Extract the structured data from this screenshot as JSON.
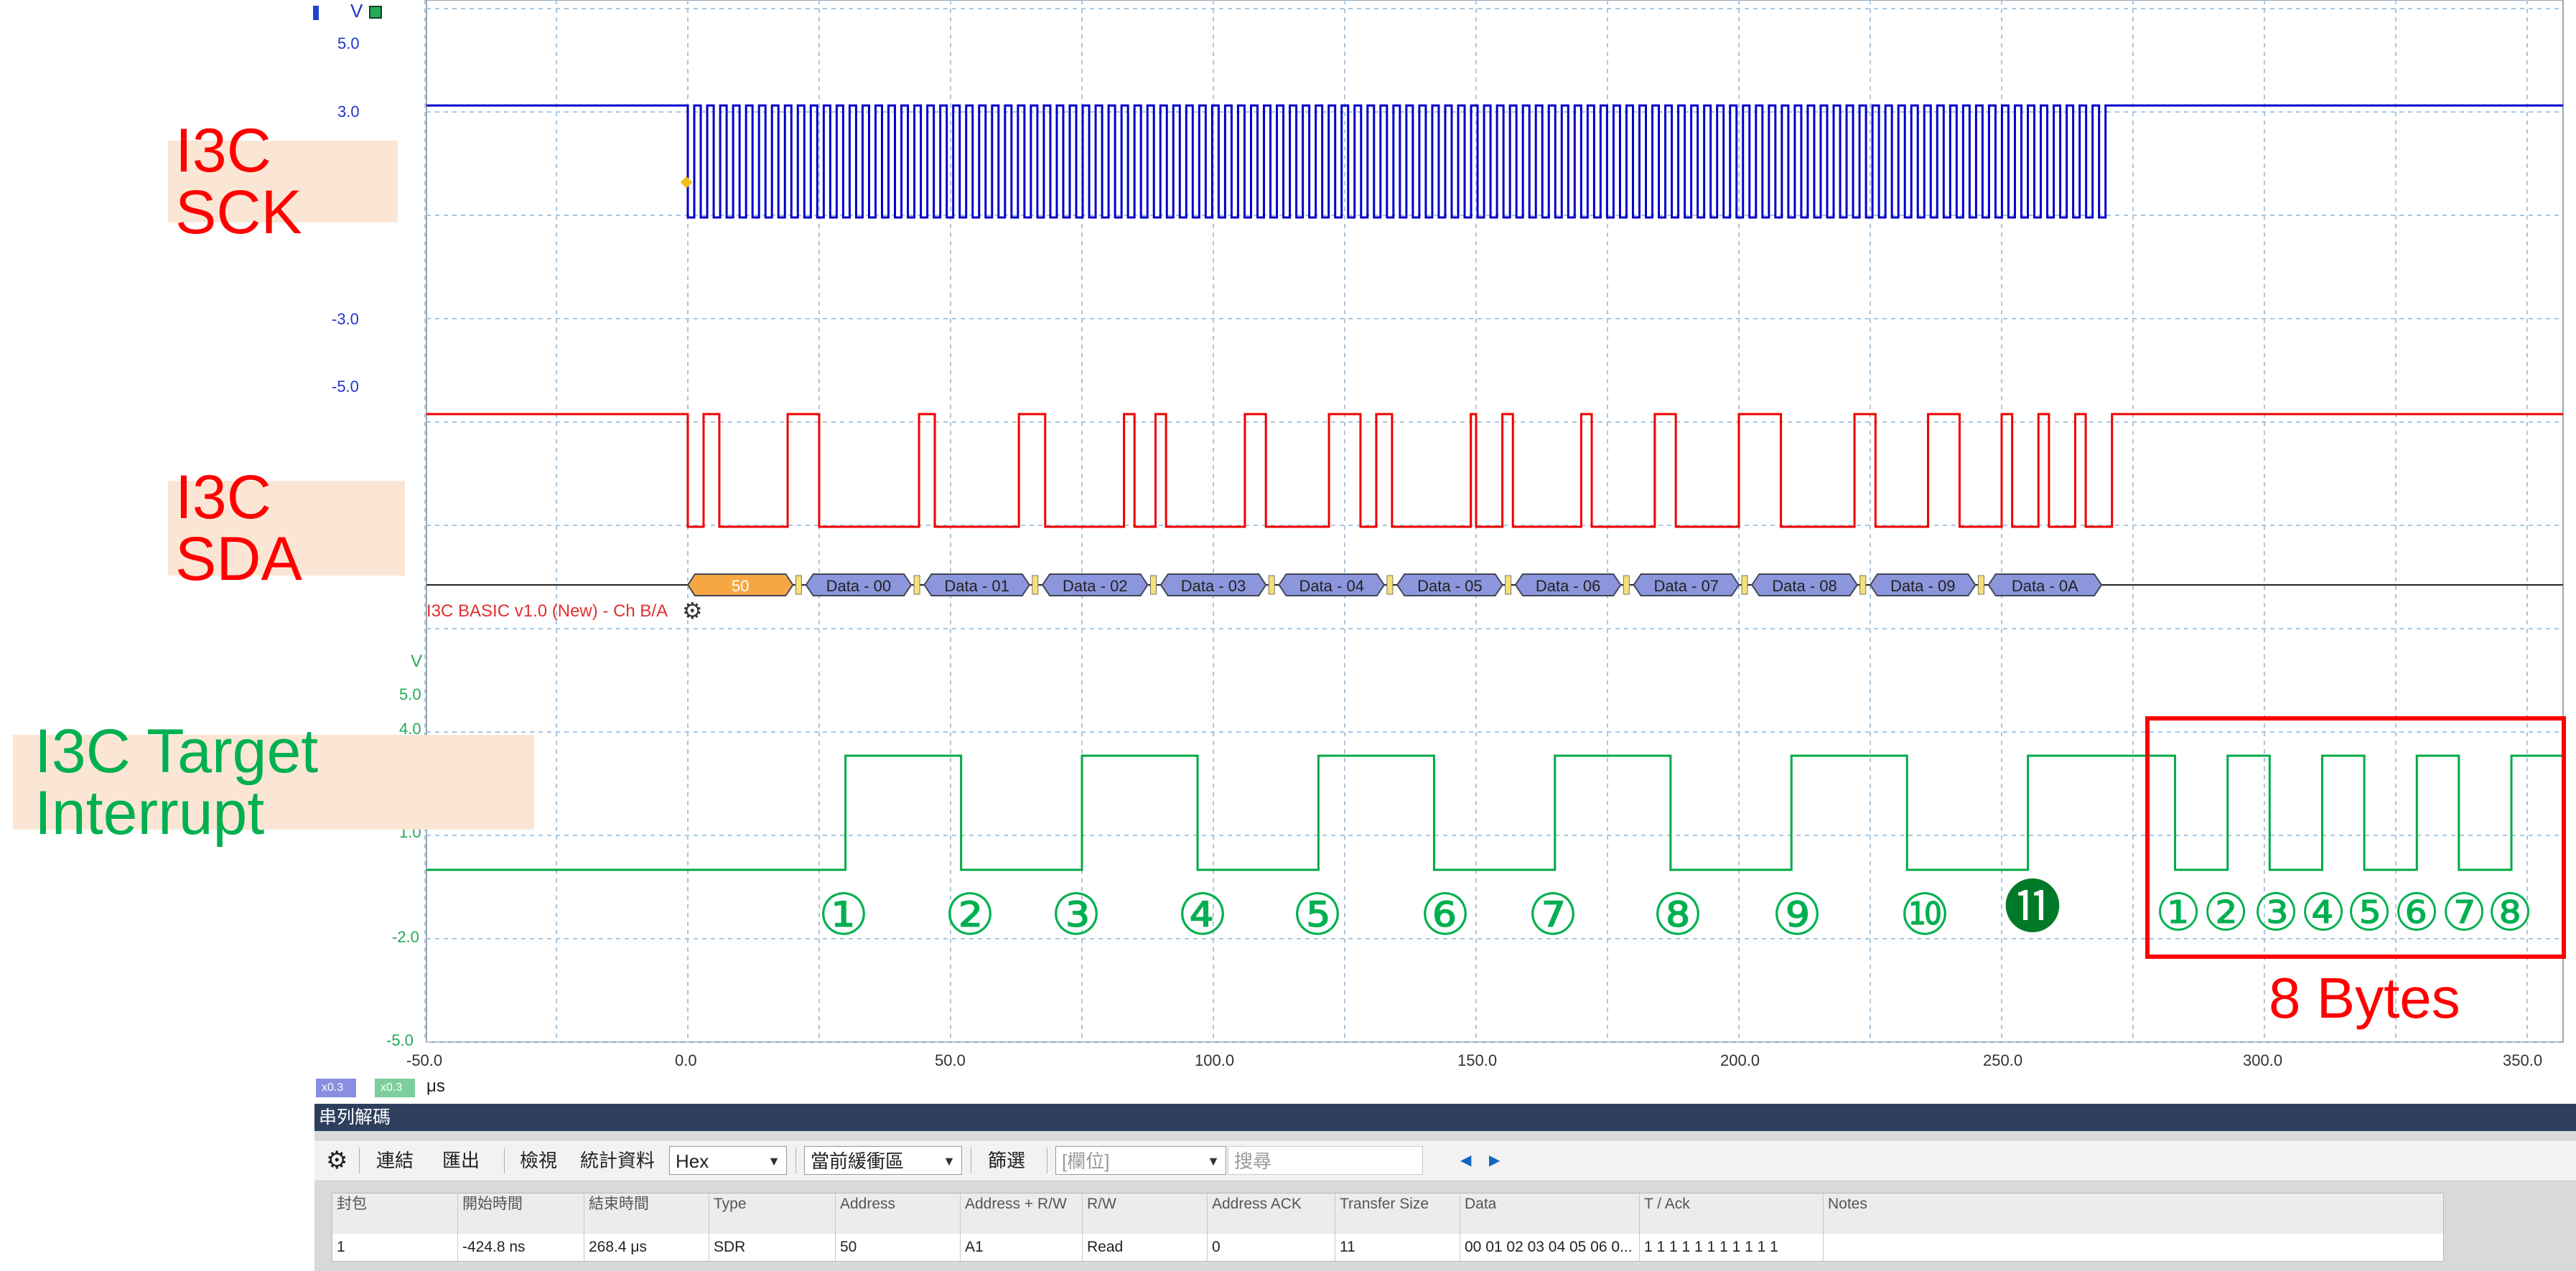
{
  "scope": {
    "volt_unit": "V",
    "upper_ticks": [
      "5.0",
      "3.0",
      "-3.0",
      "-5.0"
    ],
    "lower_ticks": [
      "V",
      "5.0",
      "4.0",
      "1.0",
      "-2.0",
      "-5.0"
    ],
    "time_ticks": [
      "-50.0",
      "0.0",
      "50.0",
      "100.0",
      "150.0",
      "200.0",
      "250.0",
      "300.0",
      "350.0"
    ],
    "time_unit": "μs",
    "scale_chips": [
      "x0.3",
      "x0.3"
    ],
    "signals": {
      "sck": {
        "label": "I3C SCK",
        "label_color": "#ff0000",
        "trace_color": "#0000cc",
        "bits": [
          1,
          1,
          1,
          1,
          1,
          1,
          1,
          1,
          1,
          1,
          1,
          1,
          1,
          1,
          1,
          1,
          1,
          1,
          1,
          1,
          1,
          1,
          1,
          1,
          1,
          1,
          1,
          1,
          1,
          1,
          1,
          1,
          1,
          1,
          1,
          1,
          1,
          1,
          1,
          1,
          1,
          1,
          1,
          1,
          1,
          1,
          1,
          1,
          1,
          1,
          1,
          1,
          1,
          1,
          1,
          1,
          1,
          1,
          1,
          1,
          1,
          1,
          1,
          1,
          1,
          1,
          1,
          1,
          1,
          1,
          1,
          1,
          1,
          1,
          1,
          1,
          1,
          1,
          1,
          1,
          1,
          1,
          1,
          1,
          1,
          1,
          1,
          1,
          1,
          1,
          1,
          1,
          1,
          1,
          1,
          1,
          1,
          1,
          1,
          1,
          1,
          1,
          1,
          1,
          1,
          1,
          1,
          1,
          1,
          1
        ]
      },
      "sda": {
        "label": "I3C SDA",
        "label_color": "#ff0000",
        "trace_color": "#ee0000"
      },
      "interrupt": {
        "label": "I3C Target Interrupt",
        "label_color": "#00b050",
        "trace_color": "#00aa44"
      }
    },
    "protocol_label": "I3C BASIC v1.0 (New) - Ch B/A",
    "protocol_color": "#e03030",
    "decode_packets": [
      {
        "text": "50",
        "kind": "address"
      },
      {
        "text": "Data - 00",
        "kind": "data"
      },
      {
        "text": "Data - 01",
        "kind": "data"
      },
      {
        "text": "Data - 02",
        "kind": "data"
      },
      {
        "text": "Data - 03",
        "kind": "data"
      },
      {
        "text": "Data - 04",
        "kind": "data"
      },
      {
        "text": "Data - 05",
        "kind": "data"
      },
      {
        "text": "Data - 06",
        "kind": "data"
      },
      {
        "text": "Data - 07",
        "kind": "data"
      },
      {
        "text": "Data - 08",
        "kind": "data"
      },
      {
        "text": "Data - 09",
        "kind": "data"
      },
      {
        "text": "Data - 0A",
        "kind": "data"
      }
    ],
    "address_packet_color": "#f5a742",
    "data_packet_color": "#8c96dc",
    "annotations": {
      "markers_main": [
        "①",
        "②",
        "③",
        "④",
        "⑤",
        "⑥",
        "⑦",
        "⑧",
        "⑨",
        "⑩"
      ],
      "marker_filled": "⓫",
      "markers_bytes": [
        "①",
        "②",
        "③",
        "④",
        "⑤",
        "⑥",
        "⑦",
        "⑧"
      ],
      "marker_color": "#00b050",
      "filled_marker_color": "#007a28",
      "box_label": "8 Bytes",
      "box_color": "#ff0000"
    }
  },
  "decode_panel": {
    "title": "串列解碼",
    "toolbar": {
      "connect": "連結",
      "export": "匯出",
      "view": "檢視",
      "stats": "統計資料",
      "format_value": "Hex",
      "buffer_value": "當前緩衝區",
      "filter": "篩選",
      "field_placeholder": "[欄位]",
      "search_placeholder": "搜尋"
    },
    "columns": [
      "封包",
      "開始時間",
      "結束時間",
      "Type",
      "Address",
      "Address + R/W",
      "R/W",
      "Address ACK",
      "Transfer Size",
      "Data",
      "T / Ack",
      "Notes"
    ],
    "rows": [
      [
        "1",
        "-424.8 ns",
        "268.4 μs",
        "SDR",
        "50",
        "A1",
        "Read",
        "0",
        "11",
        "00 01 02 03 04 05 06 0...",
        "1 1 1 1 1 1 1 1 1 1 1",
        ""
      ]
    ]
  }
}
